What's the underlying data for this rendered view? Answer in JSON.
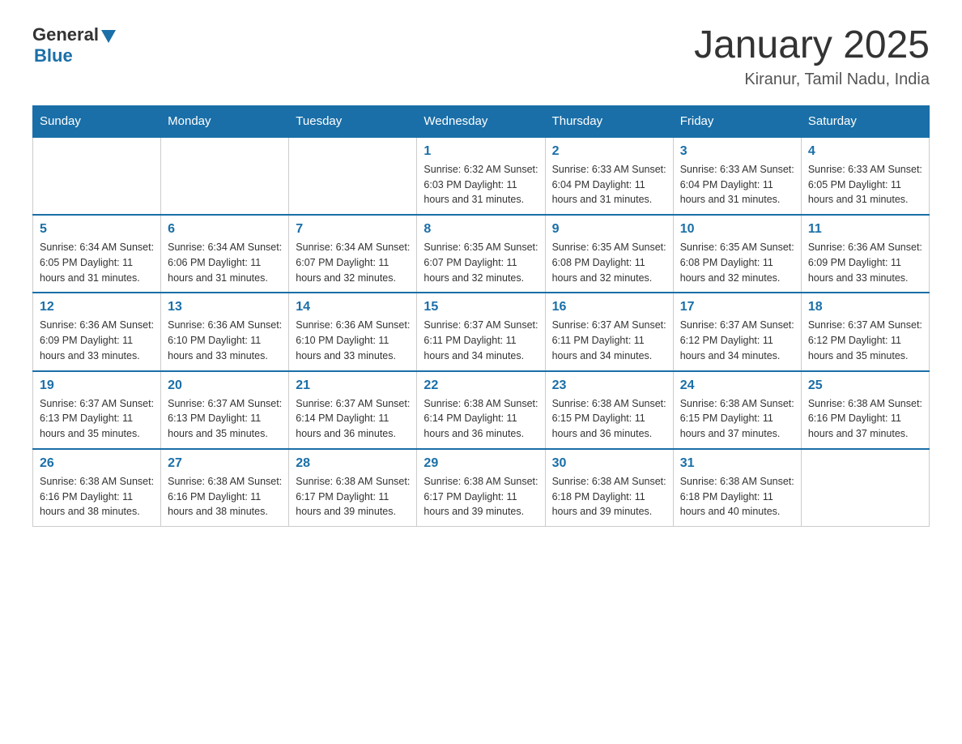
{
  "header": {
    "title": "January 2025",
    "subtitle": "Kiranur, Tamil Nadu, India",
    "logo_general": "General",
    "logo_blue": "Blue"
  },
  "weekdays": [
    "Sunday",
    "Monday",
    "Tuesday",
    "Wednesday",
    "Thursday",
    "Friday",
    "Saturday"
  ],
  "weeks": [
    [
      {
        "day": "",
        "info": ""
      },
      {
        "day": "",
        "info": ""
      },
      {
        "day": "",
        "info": ""
      },
      {
        "day": "1",
        "info": "Sunrise: 6:32 AM\nSunset: 6:03 PM\nDaylight: 11 hours and 31 minutes."
      },
      {
        "day": "2",
        "info": "Sunrise: 6:33 AM\nSunset: 6:04 PM\nDaylight: 11 hours and 31 minutes."
      },
      {
        "day": "3",
        "info": "Sunrise: 6:33 AM\nSunset: 6:04 PM\nDaylight: 11 hours and 31 minutes."
      },
      {
        "day": "4",
        "info": "Sunrise: 6:33 AM\nSunset: 6:05 PM\nDaylight: 11 hours and 31 minutes."
      }
    ],
    [
      {
        "day": "5",
        "info": "Sunrise: 6:34 AM\nSunset: 6:05 PM\nDaylight: 11 hours and 31 minutes."
      },
      {
        "day": "6",
        "info": "Sunrise: 6:34 AM\nSunset: 6:06 PM\nDaylight: 11 hours and 31 minutes."
      },
      {
        "day": "7",
        "info": "Sunrise: 6:34 AM\nSunset: 6:07 PM\nDaylight: 11 hours and 32 minutes."
      },
      {
        "day": "8",
        "info": "Sunrise: 6:35 AM\nSunset: 6:07 PM\nDaylight: 11 hours and 32 minutes."
      },
      {
        "day": "9",
        "info": "Sunrise: 6:35 AM\nSunset: 6:08 PM\nDaylight: 11 hours and 32 minutes."
      },
      {
        "day": "10",
        "info": "Sunrise: 6:35 AM\nSunset: 6:08 PM\nDaylight: 11 hours and 32 minutes."
      },
      {
        "day": "11",
        "info": "Sunrise: 6:36 AM\nSunset: 6:09 PM\nDaylight: 11 hours and 33 minutes."
      }
    ],
    [
      {
        "day": "12",
        "info": "Sunrise: 6:36 AM\nSunset: 6:09 PM\nDaylight: 11 hours and 33 minutes."
      },
      {
        "day": "13",
        "info": "Sunrise: 6:36 AM\nSunset: 6:10 PM\nDaylight: 11 hours and 33 minutes."
      },
      {
        "day": "14",
        "info": "Sunrise: 6:36 AM\nSunset: 6:10 PM\nDaylight: 11 hours and 33 minutes."
      },
      {
        "day": "15",
        "info": "Sunrise: 6:37 AM\nSunset: 6:11 PM\nDaylight: 11 hours and 34 minutes."
      },
      {
        "day": "16",
        "info": "Sunrise: 6:37 AM\nSunset: 6:11 PM\nDaylight: 11 hours and 34 minutes."
      },
      {
        "day": "17",
        "info": "Sunrise: 6:37 AM\nSunset: 6:12 PM\nDaylight: 11 hours and 34 minutes."
      },
      {
        "day": "18",
        "info": "Sunrise: 6:37 AM\nSunset: 6:12 PM\nDaylight: 11 hours and 35 minutes."
      }
    ],
    [
      {
        "day": "19",
        "info": "Sunrise: 6:37 AM\nSunset: 6:13 PM\nDaylight: 11 hours and 35 minutes."
      },
      {
        "day": "20",
        "info": "Sunrise: 6:37 AM\nSunset: 6:13 PM\nDaylight: 11 hours and 35 minutes."
      },
      {
        "day": "21",
        "info": "Sunrise: 6:37 AM\nSunset: 6:14 PM\nDaylight: 11 hours and 36 minutes."
      },
      {
        "day": "22",
        "info": "Sunrise: 6:38 AM\nSunset: 6:14 PM\nDaylight: 11 hours and 36 minutes."
      },
      {
        "day": "23",
        "info": "Sunrise: 6:38 AM\nSunset: 6:15 PM\nDaylight: 11 hours and 36 minutes."
      },
      {
        "day": "24",
        "info": "Sunrise: 6:38 AM\nSunset: 6:15 PM\nDaylight: 11 hours and 37 minutes."
      },
      {
        "day": "25",
        "info": "Sunrise: 6:38 AM\nSunset: 6:16 PM\nDaylight: 11 hours and 37 minutes."
      }
    ],
    [
      {
        "day": "26",
        "info": "Sunrise: 6:38 AM\nSunset: 6:16 PM\nDaylight: 11 hours and 38 minutes."
      },
      {
        "day": "27",
        "info": "Sunrise: 6:38 AM\nSunset: 6:16 PM\nDaylight: 11 hours and 38 minutes."
      },
      {
        "day": "28",
        "info": "Sunrise: 6:38 AM\nSunset: 6:17 PM\nDaylight: 11 hours and 39 minutes."
      },
      {
        "day": "29",
        "info": "Sunrise: 6:38 AM\nSunset: 6:17 PM\nDaylight: 11 hours and 39 minutes."
      },
      {
        "day": "30",
        "info": "Sunrise: 6:38 AM\nSunset: 6:18 PM\nDaylight: 11 hours and 39 minutes."
      },
      {
        "day": "31",
        "info": "Sunrise: 6:38 AM\nSunset: 6:18 PM\nDaylight: 11 hours and 40 minutes."
      },
      {
        "day": "",
        "info": ""
      }
    ]
  ]
}
